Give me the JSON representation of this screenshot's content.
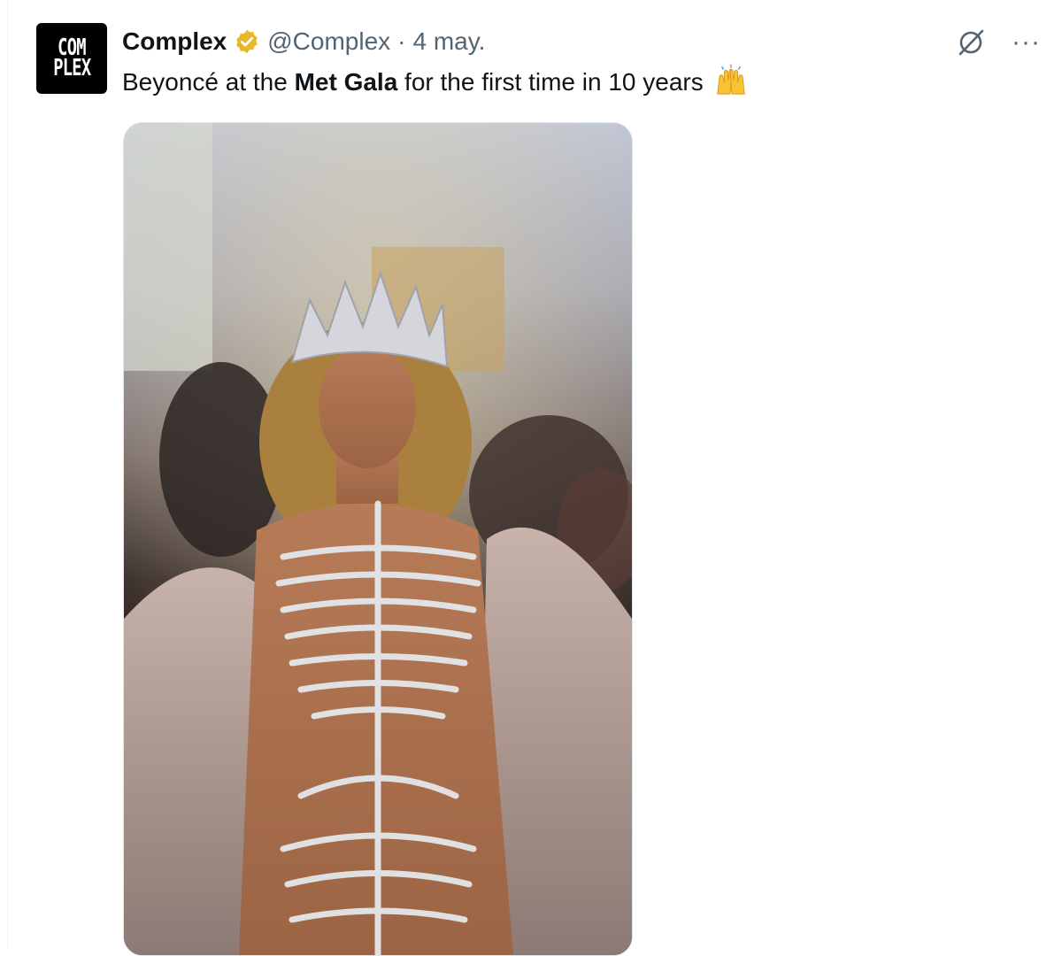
{
  "tweet": {
    "avatar_line1": "COM",
    "avatar_line2": "PLEX",
    "author_name": "Complex",
    "handle": "@Complex",
    "separator": "·",
    "date": "4 may.",
    "text_before": "Beyoncé at the ",
    "text_bold": "Met Gala",
    "text_after": " for the first time in 10 years",
    "emoji": "raising-hands-icon",
    "verified_color": "#e8b829"
  },
  "actions": {
    "grok_icon": "grok-icon",
    "more_label": "···"
  },
  "colors": {
    "text_primary": "#0f1419",
    "text_secondary": "#536471"
  }
}
